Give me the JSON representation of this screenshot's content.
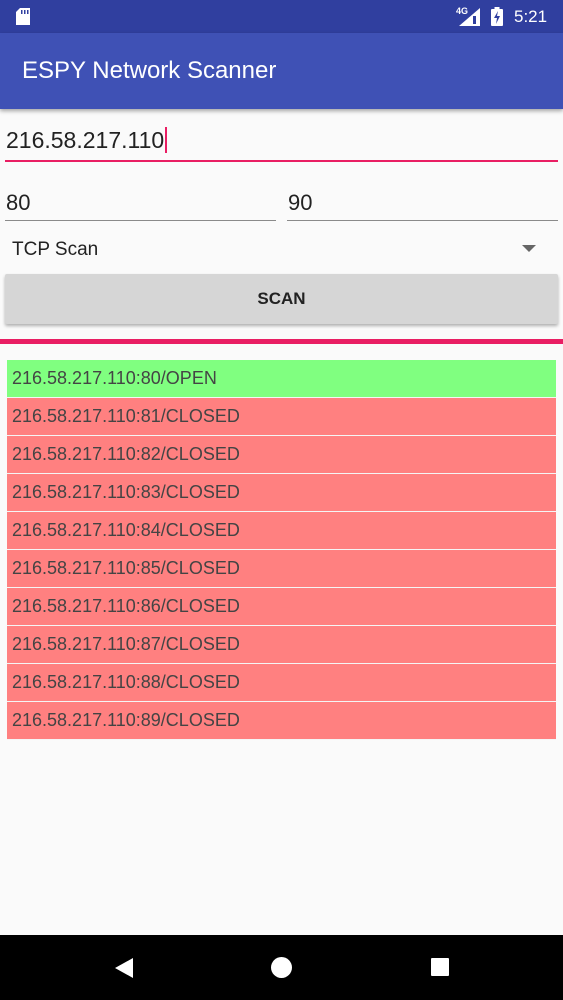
{
  "status_bar": {
    "network_type": "4G",
    "time": "5:21",
    "icons": [
      "sd-card-icon",
      "signal-icon",
      "battery-icon"
    ]
  },
  "app_bar": {
    "title": "ESPY Network Scanner"
  },
  "form": {
    "ip_address": "216.58.217.110",
    "port_start": "80",
    "port_end": "90",
    "scan_type": "TCP Scan",
    "scan_button_label": "SCAN"
  },
  "colors": {
    "status_bar": "#303f9f",
    "app_bar": "#3f51b5",
    "accent": "#e91e63",
    "open": "#80ff80",
    "closed": "#ff8080"
  },
  "results": [
    {
      "text": "216.58.217.110:80/OPEN",
      "status": "open"
    },
    {
      "text": "216.58.217.110:81/CLOSED",
      "status": "closed"
    },
    {
      "text": "216.58.217.110:82/CLOSED",
      "status": "closed"
    },
    {
      "text": "216.58.217.110:83/CLOSED",
      "status": "closed"
    },
    {
      "text": "216.58.217.110:84/CLOSED",
      "status": "closed"
    },
    {
      "text": "216.58.217.110:85/CLOSED",
      "status": "closed"
    },
    {
      "text": "216.58.217.110:86/CLOSED",
      "status": "closed"
    },
    {
      "text": "216.58.217.110:87/CLOSED",
      "status": "closed"
    },
    {
      "text": "216.58.217.110:88/CLOSED",
      "status": "closed"
    },
    {
      "text": "216.58.217.110:89/CLOSED",
      "status": "closed"
    }
  ],
  "nav_bar": {
    "icons": [
      "back-icon",
      "home-icon",
      "recents-icon"
    ]
  }
}
